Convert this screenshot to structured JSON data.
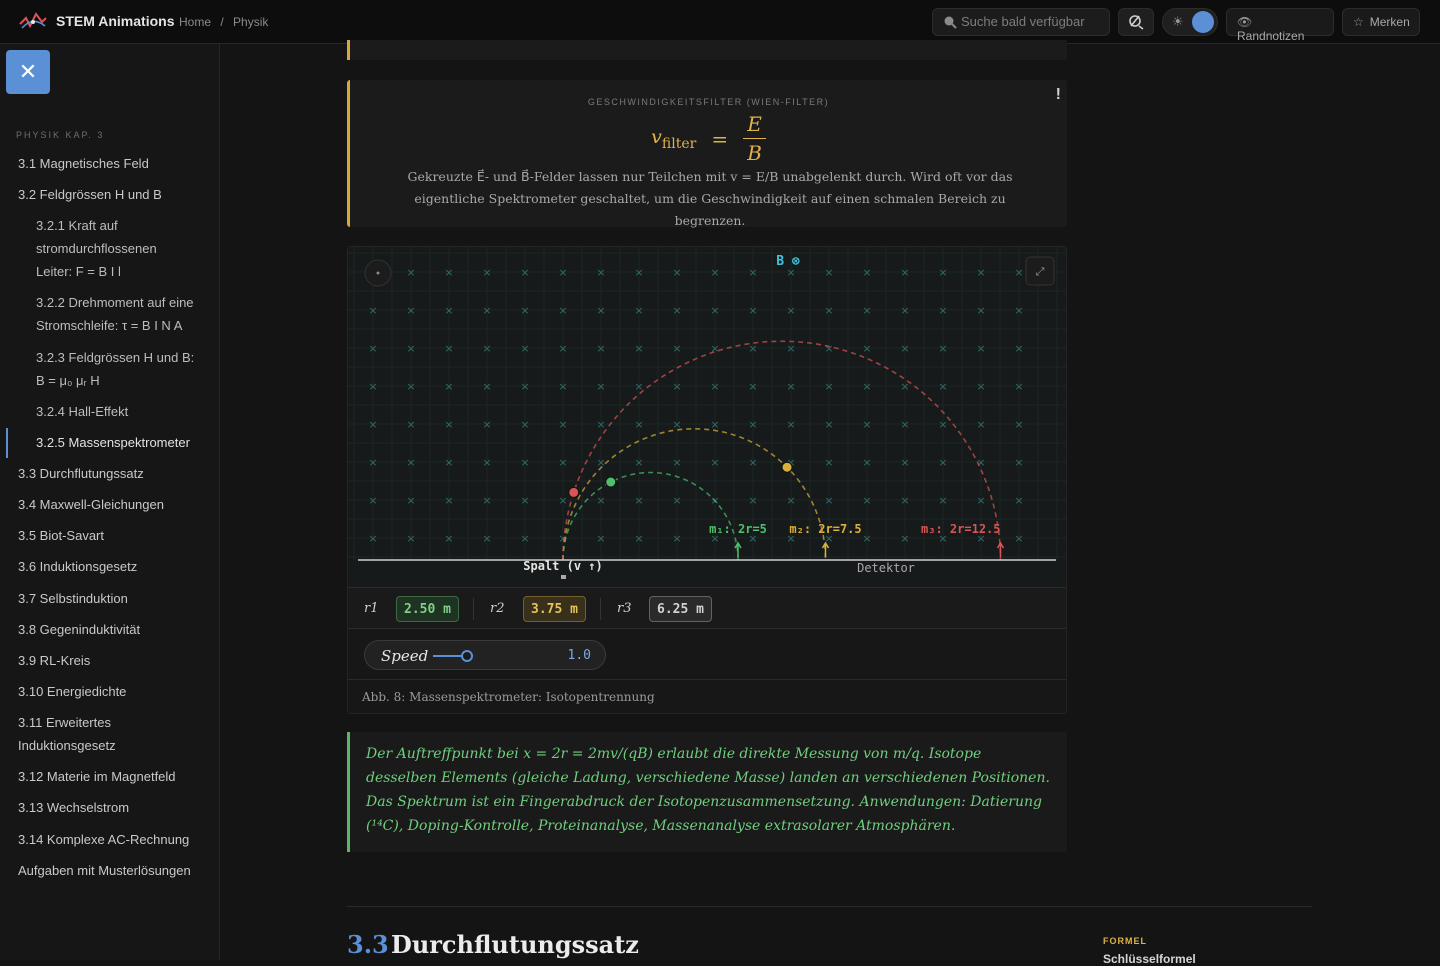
{
  "header": {
    "brand": "STEM Animations",
    "breadcrumb": [
      "Home",
      "/",
      "Physik"
    ],
    "search_placeholder": "Suche bald verfügbar",
    "randnotizen_label": "Randnotizen",
    "merken_label": "Merken",
    "theme_icon": "sun-icon",
    "accent": "#5b8fd6"
  },
  "sidebar": {
    "close_label": "✕",
    "heading": "PHYSIK KAP. 3",
    "items": [
      {
        "label": "3.1 Magnetisches Feld"
      },
      {
        "label": "3.2 Feldgrössen H und B"
      },
      {
        "label_lines": [
          "3.2.1 Kraft auf",
          "stromdurchflossenen",
          "Leiter: F = B I l"
        ]
      },
      {
        "label_lines": [
          "3.2.2 Drehmoment auf eine",
          "Stromschleife: τ = B I N A"
        ]
      },
      {
        "label_lines": [
          "3.2.3 Feldgrössen H und B:",
          "B = μ₀ μᵣ H"
        ]
      },
      {
        "label": "3.2.4 Hall-Effekt"
      },
      {
        "label": "3.2.5 Massenspektrometer",
        "active": true
      },
      {
        "label": "3.3 Durchflutungssatz"
      },
      {
        "label": "3.4 Maxwell-Gleichungen"
      },
      {
        "label": "3.5 Biot-Savart"
      },
      {
        "label": "3.6 Induktionsgesetz"
      },
      {
        "label": "3.7 Selbstinduktion"
      },
      {
        "label": "3.8 Gegeninduktivität"
      },
      {
        "label": "3.9 RL-Kreis"
      },
      {
        "label": "3.10 Energiedichte"
      },
      {
        "label_lines": [
          "3.11 Erweitertes",
          "Induktionsgesetz"
        ]
      },
      {
        "label": "3.12 Materie im Magnetfeld"
      },
      {
        "label": "3.13 Wechselstrom"
      },
      {
        "label": "3.14 Komplexe AC-Rechnung"
      },
      {
        "label": "Aufgaben mit Musterlösungen"
      }
    ]
  },
  "callout": {
    "label": "GESCHWINDIGKEITSFILTER (WIEN-FILTER)",
    "bang": "!",
    "formula_lhs": "v",
    "formula_sub": "filter",
    "formula_eq": "=",
    "formula_num": "E",
    "formula_den": "B",
    "description": "Gekreuzte E⃗- und B⃗-Felder lassen nur Teilchen mit v = E/B unabgelenkt durch. Wird oft vor das eigentliche Spektrometer geschaltet, um die Geschwindigkeit auf einen schmalen Bereich zu begrenzen."
  },
  "simulation": {
    "field_label": "B ⊗",
    "slit_label": "Spalt (v ↑)",
    "detector_label": "Detektor",
    "tracks": [
      {
        "label": "m₁: 2r=5",
        "radius": 2.5,
        "color": "#4fbf6a",
        "progress": 0.35
      },
      {
        "label": "m₂: 2r=7.5",
        "radius": 3.75,
        "color": "#d9b03a",
        "progress": 0.75
      },
      {
        "label": "m₃: 2r=12.5",
        "radius": 6.25,
        "color": "#d95555",
        "progress": 0.1
      }
    ],
    "readouts": [
      {
        "label": "r1",
        "value": "2.50 m",
        "color": "#7fd08a",
        "bg": "#1f3323"
      },
      {
        "label": "r2",
        "value": "3.75 m",
        "color": "#e6c25a",
        "bg": "#38301a"
      },
      {
        "label": "r3",
        "value": "6.25 m",
        "color": "#d2d2d2",
        "bg": "#2a2a2a"
      }
    ],
    "speed_label": "Speed",
    "speed_value": "1.0",
    "caption": "Abb. 8: Massenspektrometer: Isotopentrennung"
  },
  "note": {
    "text": "Der Auftreffpunkt bei x = 2r = 2mv/(qB) erlaubt die direkte Messung von m/q. Isotope desselben Elements (gleiche Ladung, verschiedene Masse) landen an verschiedenen Positionen. Das Spektrum ist ein Fingerabdruck der Isotopenzusammensetzung. Anwendungen: Datierung (¹⁴C), Doping-Kontrolle, Proteinanalyse, Massenanalyse extrasolarer Atmosphären."
  },
  "section": {
    "number": "3.3",
    "title": "Durchflutungssatz",
    "side_label": "FORMEL",
    "side_title": "Schlüsselformel"
  }
}
